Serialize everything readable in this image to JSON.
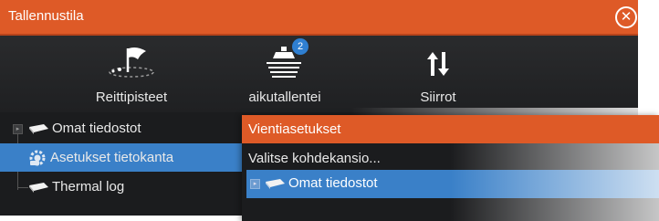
{
  "dialog": {
    "title": "Tallennustila",
    "close_icon": "close-circle-icon"
  },
  "toolbar": {
    "items": [
      {
        "label": "Reittipisteet",
        "icon": "waypoint-flag-icon"
      },
      {
        "label": "aikutallentei",
        "icon": "recording-boat-icon",
        "badge": "2"
      },
      {
        "label": "Siirrot",
        "icon": "transfer-arrows-icon"
      }
    ]
  },
  "tree": {
    "items": [
      {
        "label": "Omat tiedostot",
        "icon": "storage-card-icon"
      },
      {
        "label": "Asetukset tietokanta",
        "icon": "settings-gear-icon"
      },
      {
        "label": "Thermal log",
        "icon": "storage-card-icon"
      }
    ]
  },
  "popup": {
    "title": "Vientiasetukset",
    "instruction": "Valitse kohdekansio...",
    "item": {
      "label": "Omat tiedostot",
      "icon": "storage-card-icon"
    }
  },
  "colors": {
    "accent_orange": "#de5a27",
    "selection_blue": "#3a80c8",
    "background_dark": "#1b1c1e",
    "badge_blue": "#2f7fd1"
  }
}
